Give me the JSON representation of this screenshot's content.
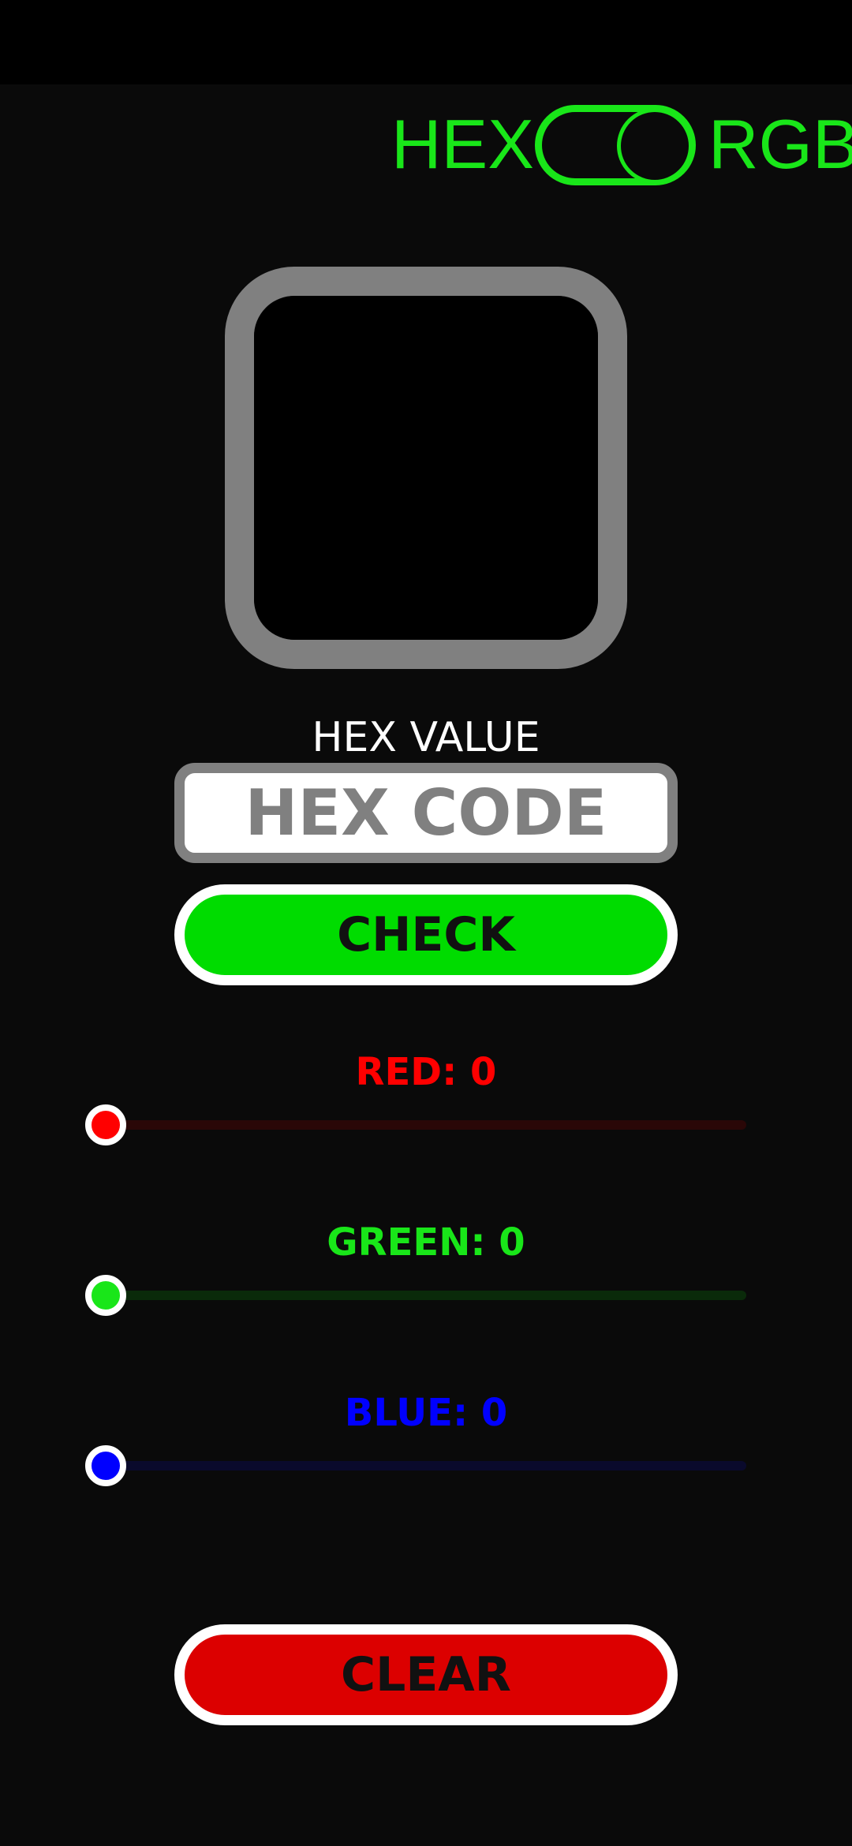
{
  "mode_toggle": {
    "left_label": "HEX",
    "right_label": "RGB",
    "selected": "RGB"
  },
  "color_preview": {
    "color": "#000000"
  },
  "hex": {
    "label": "HEX VALUE",
    "input_value": "",
    "input_placeholder": "HEX CODE",
    "check_label": "CHECK"
  },
  "sliders": {
    "red": {
      "label": "RED: 0",
      "value": 0,
      "max": 255,
      "color": "#ff0000",
      "track_color": "#2a0707"
    },
    "green": {
      "label": "GREEN: 0",
      "value": 0,
      "max": 255,
      "color": "#19e619",
      "track_color": "#0a2a0a"
    },
    "blue": {
      "label": "BLUE: 0",
      "value": 0,
      "max": 255,
      "color": "#0000ff",
      "track_color": "#0a0a2c"
    }
  },
  "clear_label": "CLEAR",
  "colors": {
    "accent_green": "#19e619",
    "check_button": "#00dc00",
    "clear_button": "#dc0000",
    "frame_gray": "#808080"
  }
}
